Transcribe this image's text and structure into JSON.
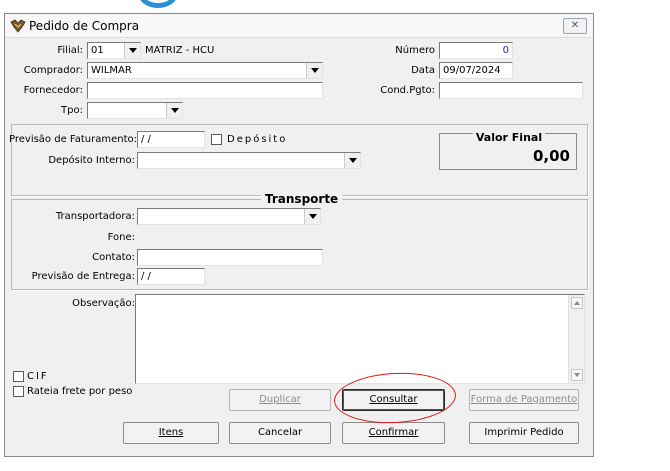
{
  "window": {
    "title": "Pedido de Compra",
    "close_glyph": "✕"
  },
  "header": {
    "filial_label": "Filial:",
    "filial_value": "01",
    "filial_name": "MATRIZ - HCU",
    "comprador_label": "Comprador:",
    "comprador_value": "WILMAR",
    "fornecedor_label": "Fornecedor:",
    "fornecedor_value": "",
    "tpo_label": "Tpo:",
    "tpo_value": "",
    "numero_label": "Número",
    "numero_value": "0",
    "data_label": "Data",
    "data_value": "09/07/2024",
    "condpgto_label": "Cond.Pgto:",
    "condpgto_value": ""
  },
  "faturamento": {
    "previsao_label": "Previsão de Faturamento:",
    "previsao_value": " / /",
    "deposito_label": "Depósito",
    "deposito_interno_label": "Depósito Interno:",
    "deposito_interno_value": "",
    "valor_final_label": "Valor Final",
    "valor_final_value": "0,00"
  },
  "transporte": {
    "group_title": "Transporte",
    "transportadora_label": "Transportadora:",
    "transportadora_value": "",
    "fone_label": "Fone:",
    "contato_label": "Contato:",
    "contato_value": "",
    "previsao_entrega_label": "Previsão de Entrega:",
    "previsao_entrega_value": " / /"
  },
  "observacao": {
    "label": "Observação:",
    "value": ""
  },
  "options": {
    "cif_label": "CIF",
    "rateia_label": "Rateia frete por peso"
  },
  "buttons": {
    "duplicar": "Duplicar",
    "consultar": "Consultar",
    "forma_pagamento": "Forma de Pagamento",
    "itens": "Itens",
    "cancelar": "Cancelar",
    "confirmar": "Confirmar",
    "imprimir": "Imprimir Pedido"
  },
  "icons": {
    "app": "app-icon",
    "close": "close-icon",
    "annotation_color": "#e01818"
  }
}
